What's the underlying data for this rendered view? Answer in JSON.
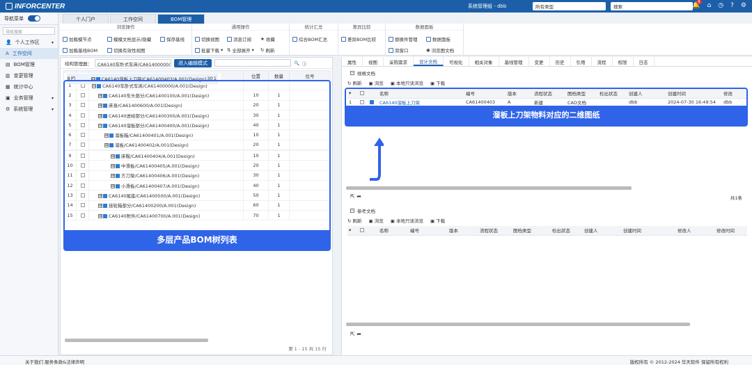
{
  "header": {
    "logo": "INFORCENTER",
    "user": "系统管理组 - dbb",
    "type_select": "所有类型",
    "search": "搜索",
    "notif_count": "8"
  },
  "sidebar": {
    "toggle_label": "导航菜单",
    "search_placeholder": "导航搜索",
    "items": [
      "个人工作区",
      "工作空间",
      "BOM管理",
      "变更管理",
      "统计中心",
      "业务管理",
      "系统管理"
    ]
  },
  "tabs": [
    "个人门户",
    "工作空间",
    "BOM管理"
  ],
  "ribbon": {
    "g1": {
      "title": "浏览操作",
      "b1": "加载模节点",
      "b2": "模模文档显示/隐藏",
      "b3": "保存基线",
      "b4": "加载基线BOM",
      "b5": "切换有效性视图"
    },
    "g2": {
      "title": "通用操作",
      "b1": "切换视图",
      "b2": "消息订阅",
      "b3": "收藏",
      "b4": "批量下载",
      "b5": "全部展开",
      "b6": "刷新"
    },
    "g3": {
      "title": "统计汇总",
      "b1": "综合BOM汇总"
    },
    "g4": {
      "title": "差异比较",
      "b1": "差异BOM比较"
    },
    "g5": {
      "title": "数据面板",
      "b1": "替换件管理",
      "b2": "数据面板",
      "b3": "双窗口",
      "b4": "浏览图文档"
    }
  },
  "left": {
    "struct_label": "结构管理器：",
    "path": "CA6140车卧式车床/CA61400000/...",
    "edit_button": "进入编辑模式",
    "columns": [
      "Bom行",
      "位置",
      "数量",
      "位号"
    ],
    "rows": [
      {
        "n": "1",
        "pm": "⊟",
        "name": "CA6140车卧式车床/CA61400000/A.001(Design)",
        "pos": "",
        "qty": "",
        "chk": ""
      },
      {
        "n": "2",
        "pm": "⊞",
        "name": "CA6140车头部分/CA61400100/A.001(Design)",
        "pos": "10",
        "qty": "1",
        "chk": ""
      },
      {
        "n": "3",
        "pm": "⊞",
        "name": "床身/CA61400600/A.001(Design)",
        "pos": "20",
        "qty": "1",
        "chk": ""
      },
      {
        "n": "4",
        "pm": "⊞",
        "name": "CA6140进给部分/CA61400300/A.001(Design)",
        "pos": "30",
        "qty": "1",
        "chk": ""
      },
      {
        "n": "5",
        "pm": "⊟",
        "name": "CA6140溜板部分/CA61400400/A.001(Design)",
        "pos": "40",
        "qty": "1",
        "chk": ""
      },
      {
        "n": "6",
        "pm": "⊞",
        "name": "溜板箱/CA61400401/A.001(Design)",
        "pos": "10",
        "qty": "1",
        "chk": ""
      },
      {
        "n": "7",
        "pm": "⊞",
        "name": "溜板/CA61400402/A.001(Design)",
        "pos": "20",
        "qty": "1",
        "chk": ""
      },
      {
        "n": "8",
        "pm": "⊟",
        "name": "CA6140溜板上刀架/CA61400403/A.001(Design)",
        "pos": "30",
        "qty": "1",
        "chk": "✔"
      },
      {
        "n": "9",
        "pm": "⊞",
        "name": "床鞍/CA61400404/A.001(Design)",
        "pos": "10",
        "qty": "1",
        "chk": ""
      },
      {
        "n": "10",
        "pm": "⊞",
        "name": "中滑板/CA61400405/A.001(Design)",
        "pos": "20",
        "qty": "1",
        "chk": ""
      },
      {
        "n": "11",
        "pm": "⊞",
        "name": "方刀架/CA61400406/A.001(Design)",
        "pos": "30",
        "qty": "1",
        "chk": ""
      },
      {
        "n": "12",
        "pm": "⊞",
        "name": "小滑板/CA61400407/A.001(Design)",
        "pos": "40",
        "qty": "1",
        "chk": ""
      },
      {
        "n": "13",
        "pm": "⊞",
        "name": "CA6140尾座/CA61400500/A.001(Design)",
        "pos": "50",
        "qty": "1",
        "chk": ""
      },
      {
        "n": "14",
        "pm": "⊞",
        "name": "挂轮箱部分/CA61400200/A.001(Design)",
        "pos": "60",
        "qty": "1",
        "chk": ""
      },
      {
        "n": "15",
        "pm": "⊞",
        "name": "CA6140附件/CA61400700/A.001(Design)",
        "pos": "70",
        "qty": "1",
        "chk": ""
      }
    ],
    "callout": "多层产品BOM树列表",
    "footer": "第 1 - 15 共 15 行"
  },
  "right": {
    "tabs": [
      "属性",
      "视图",
      "采购需求",
      "设计文档",
      "可视化",
      "相关对象",
      "基线管理",
      "变更",
      "历史",
      "引用",
      "流程",
      "权限",
      "日志"
    ],
    "sec1": {
      "title": "规格文档",
      "toolbar": [
        "刷新",
        "浏览",
        "本地只读浏览",
        "下载"
      ],
      "columns": [
        "名称",
        "编号",
        "版本",
        "流程状态",
        "图档类型",
        "检出状态",
        "创建人",
        "创建时间",
        "修改"
      ],
      "row": {
        "n": "1",
        "name": "CA6140溜板上刀架",
        "code": "CA61400403",
        "ver": "A",
        "flow": "新建",
        "type": "CAD文档",
        "checkout": "",
        "creator": "dbb",
        "created": "2024-07-30 16:49:54",
        "mod": "dbb"
      },
      "total": "共1条"
    },
    "callout": "溜板上刀架物料对应的二维图纸",
    "sec2": {
      "title": "参考文档",
      "toolbar": [
        "刷新",
        "浏览",
        "本地只读浏览",
        "下载"
      ],
      "columns": [
        "名称",
        "编号",
        "版本",
        "流程状态",
        "图档类型",
        "检出状态",
        "创建人",
        "创建时间",
        "修改人",
        "修改时间"
      ]
    }
  },
  "footer": {
    "left": "关于我们 服务条款&法律声明",
    "right": "版权所有 © 2012-2024 华天软件 保留所有权利"
  }
}
